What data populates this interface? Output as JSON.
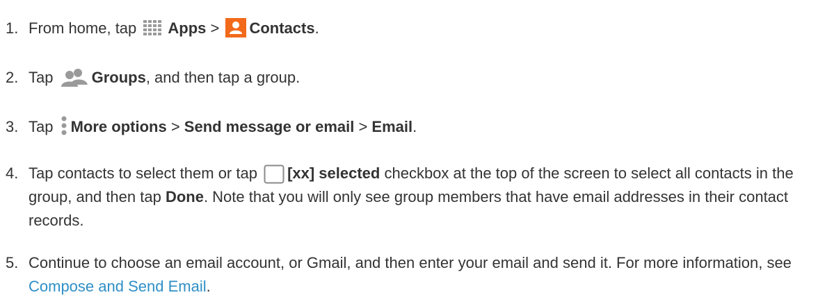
{
  "steps": [
    {
      "number": "1.",
      "t1": "From home, tap ",
      "apps_icon": "apps-grid-icon",
      "apps_label": "Apps",
      "sep": " > ",
      "contacts_icon": "contacts-icon",
      "contacts_label": "Contacts",
      "end": "."
    },
    {
      "number": "2.",
      "t1": "Tap ",
      "groups_icon": "groups-icon",
      "groups_label": "Groups",
      "t2": ", and then tap a group."
    },
    {
      "number": "3.",
      "t1": "Tap ",
      "more_icon": "more-options-icon",
      "more_label": "More options",
      "sep1": " > ",
      "send_label": "Send message or email",
      "sep2": " > ",
      "email_label": "Email",
      "end": "."
    },
    {
      "number": "4.",
      "t1": "Tap contacts to select them or tap ",
      "checkbox_icon": "checkbox-icon",
      "selected_label": "[xx] selected",
      "t2": " checkbox at the top of the screen to select all contacts in the group, and then tap ",
      "done_label": "Done",
      "t3": ". Note that you will only see group members that have email addresses in their contact records."
    },
    {
      "number": "5.",
      "t1": "Continue to choose an email account, or Gmail, and then enter your email and send it. For more information, see ",
      "link_label": "Compose and Send Email",
      "end": "."
    }
  ],
  "colors": {
    "text": "#333333",
    "link": "#2f8fc7",
    "contacts_orange": "#f26a1b",
    "icon_gray": "#9a9a9a"
  }
}
